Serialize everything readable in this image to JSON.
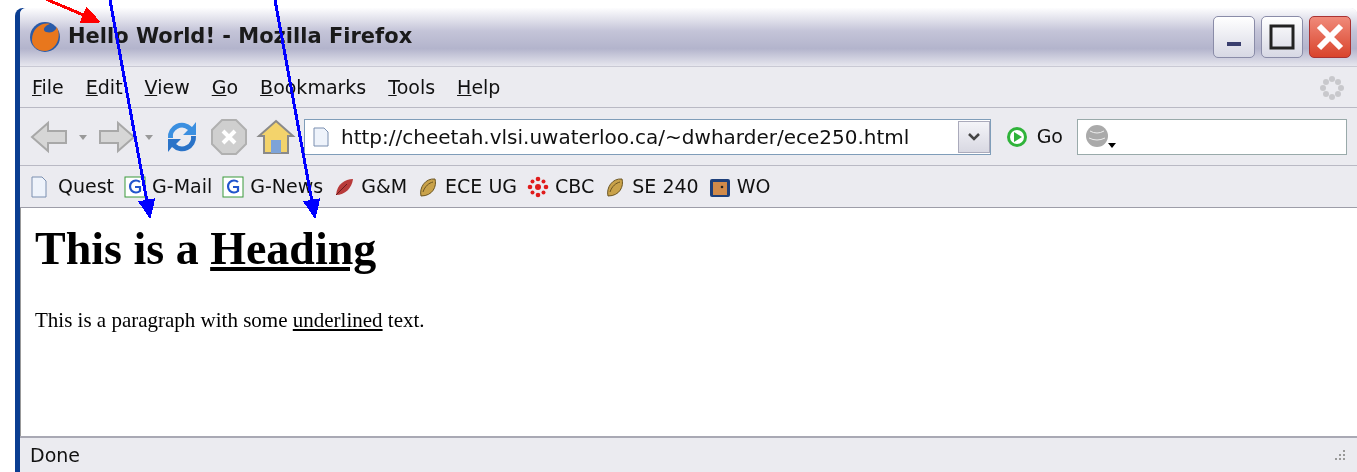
{
  "window": {
    "title": "Hello World! - Mozilla Firefox"
  },
  "menu": [
    "File",
    "Edit",
    "View",
    "Go",
    "Bookmarks",
    "Tools",
    "Help"
  ],
  "address_bar": {
    "value": "http://cheetah.vlsi.uwaterloo.ca/~dwharder/ece250.html"
  },
  "go_button": "Go",
  "bookmarks": [
    {
      "label": "Quest",
      "kind": "page"
    },
    {
      "label": "G-Mail",
      "kind": "google"
    },
    {
      "label": "G-News",
      "kind": "google"
    },
    {
      "label": "G&M",
      "kind": "leaf"
    },
    {
      "label": "ECE UG",
      "kind": "shell"
    },
    {
      "label": "CBC",
      "kind": "cbc"
    },
    {
      "label": "SE 240",
      "kind": "shell"
    },
    {
      "label": "WO",
      "kind": "folder"
    }
  ],
  "page": {
    "heading": [
      {
        "text": "This is a ",
        "underline": false
      },
      {
        "text": "Heading",
        "underline": true
      }
    ],
    "paragraph": [
      {
        "text": "This is a paragraph with some ",
        "underline": false
      },
      {
        "text": "underlined",
        "underline": true
      },
      {
        "text": " text.",
        "underline": false
      }
    ]
  },
  "status_bar": "Done",
  "annotations": [
    {
      "color": "#ff0000"
    },
    {
      "color": "#0000ff"
    },
    {
      "color": "#0000ff"
    }
  ]
}
